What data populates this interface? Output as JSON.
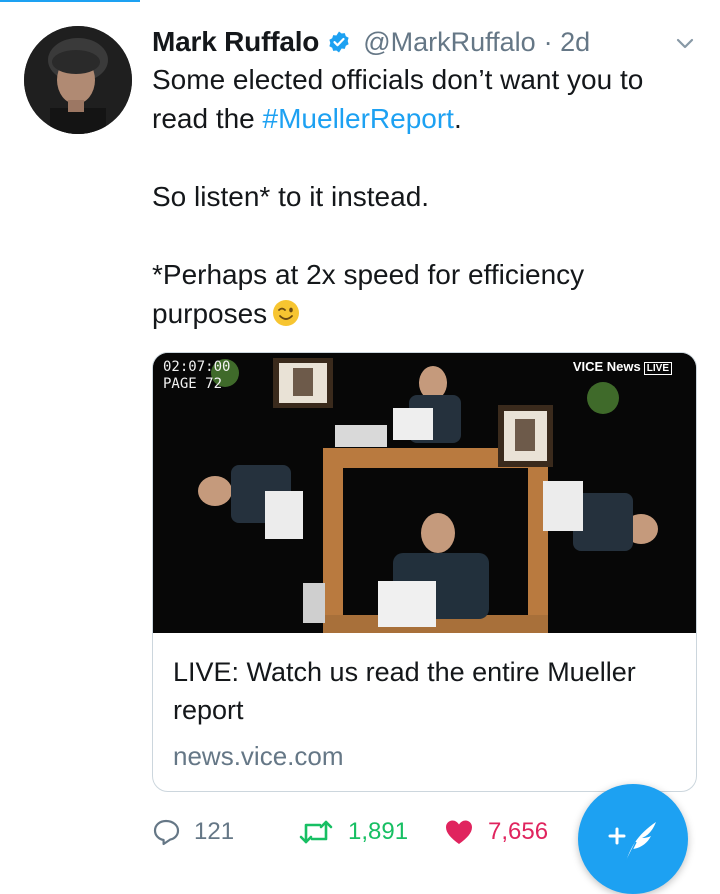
{
  "tweet": {
    "author_name": "Mark Ruffalo",
    "handle": "@MarkRuffalo",
    "time": "· 2d",
    "text_line1_a": "Some elected officials don’t want you to",
    "text_line2_a": "read the ",
    "hashtag": "#MuellerReport",
    "text_line2_b": ".",
    "text_para2": "So listen* to it instead.",
    "text_para3_line1": "*Perhaps at 2x speed for efficiency",
    "text_para3_line2": "purposes"
  },
  "card": {
    "timecode": "02:07:00",
    "page": "PAGE  72",
    "brand": "VICE News",
    "brand_live": "LIVE",
    "title": "LIVE: Watch us read the entire Mueller report",
    "domain": "news.vice.com"
  },
  "actions": {
    "replies": "121",
    "retweets": "1,891",
    "likes": "7,656"
  },
  "colors": {
    "accent": "#1da1f2",
    "retweet": "#17bf63",
    "like": "#e0245e",
    "secondary_text": "#657786"
  },
  "icons": [
    "verified-badge-icon",
    "chevron-down-icon",
    "wink-emoji-icon",
    "reply-icon",
    "retweet-icon",
    "heart-icon",
    "compose-quill-icon"
  ]
}
